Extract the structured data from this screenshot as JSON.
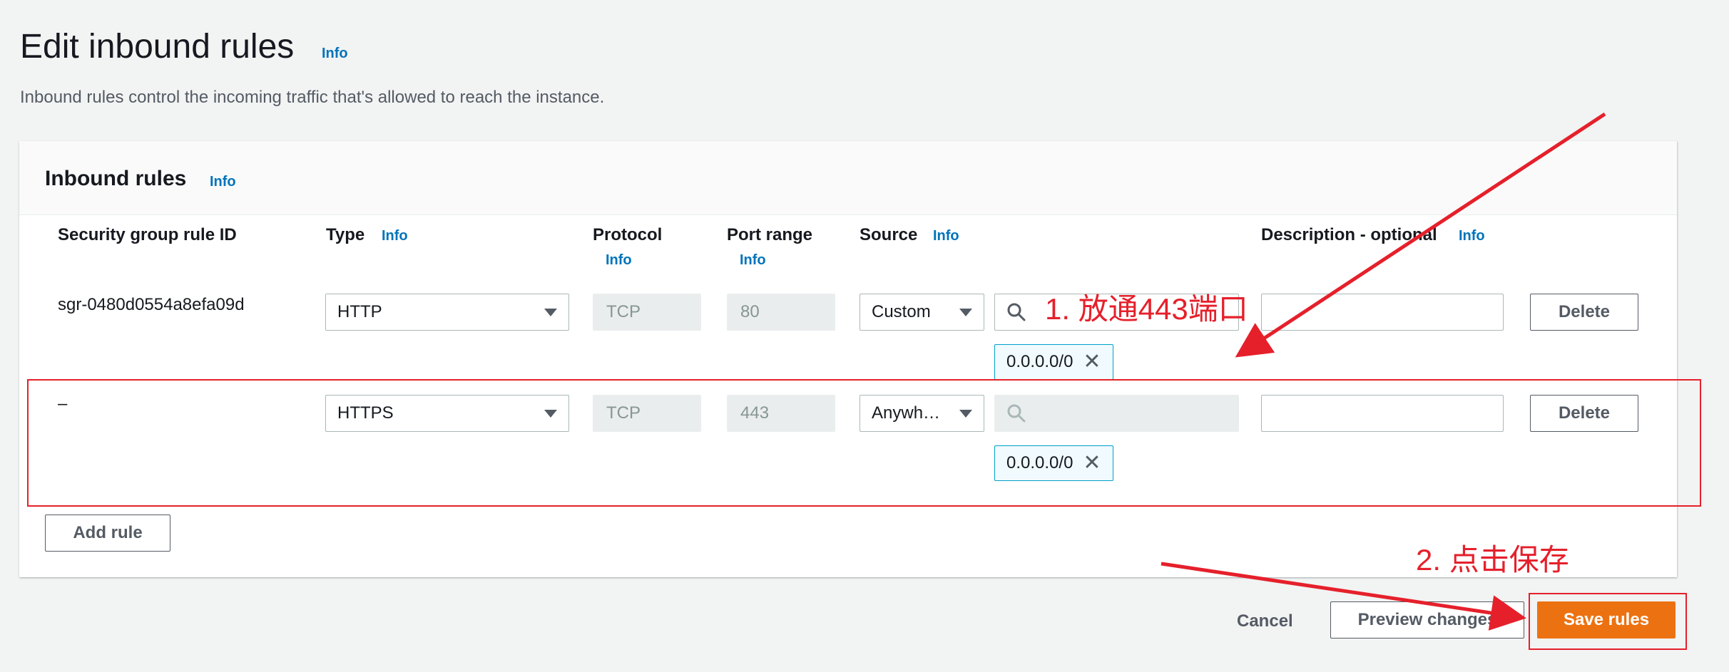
{
  "header": {
    "title": "Edit inbound rules",
    "info": "Info",
    "description": "Inbound rules control the incoming traffic that's allowed to reach the instance."
  },
  "panel": {
    "title": "Inbound rules",
    "info": "Info",
    "columns": {
      "rule_id": "Security group rule ID",
      "type": "Type",
      "protocol": "Protocol",
      "port_range": "Port range",
      "source": "Source",
      "description": "Description - optional",
      "info": "Info"
    },
    "rows": [
      {
        "rule_id": "sgr-0480d0554a8efa09d",
        "type": "HTTP",
        "protocol": "TCP",
        "port": "80",
        "source_mode": "Custom",
        "search_value": "",
        "token": "0.0.0.0/0",
        "description": "",
        "delete": "Delete"
      },
      {
        "rule_id": "–",
        "type": "HTTPS",
        "protocol": "TCP",
        "port": "443",
        "source_mode": "Anywh…",
        "search_value": "",
        "token": "0.0.0.0/0",
        "description": "",
        "delete": "Delete"
      }
    ],
    "add_rule": "Add rule"
  },
  "footer": {
    "cancel": "Cancel",
    "preview": "Preview changes",
    "save": "Save rules"
  },
  "annotations": {
    "step1": "1. 放通443端口",
    "step2": "2. 点击保存",
    "color": "#e5202b"
  },
  "icons": [
    "search-icon",
    "close-icon",
    "caret-down-icon"
  ]
}
